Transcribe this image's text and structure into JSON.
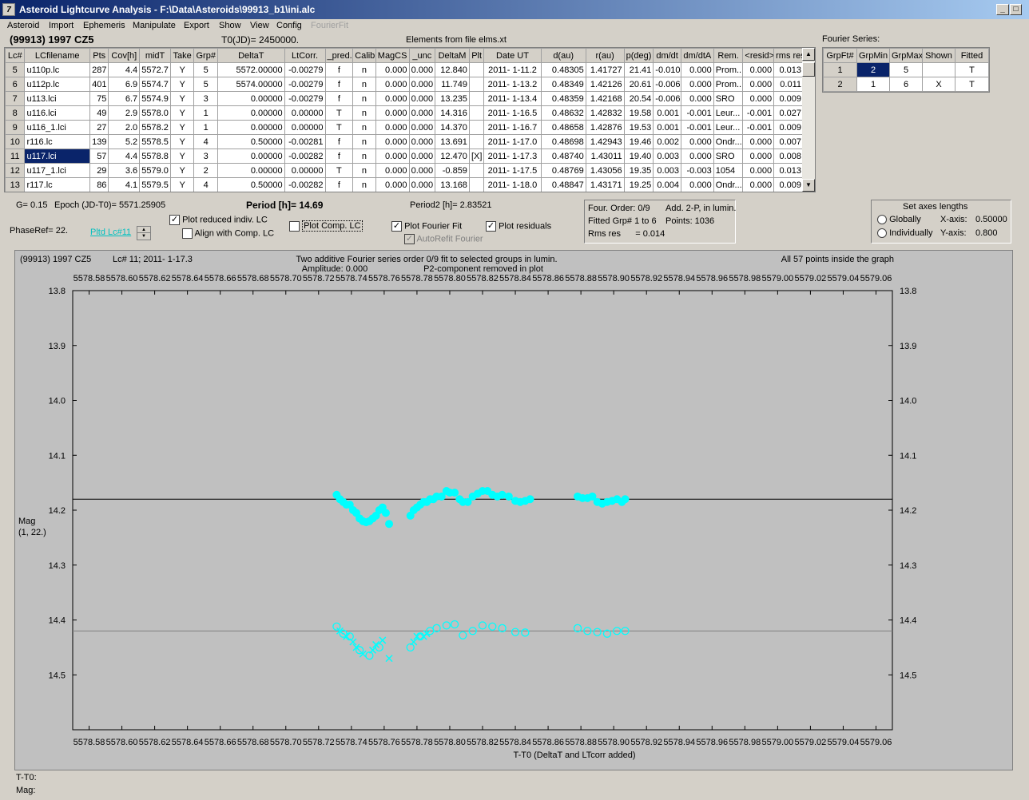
{
  "window": {
    "title": "Asteroid Lightcurve Analysis - F:\\Data\\Asteroids\\99913_b1\\ini.alc",
    "icon": "app-icon"
  },
  "menu": [
    "Asteroid",
    "Import",
    "Ephemeris",
    "Manipulate",
    "Export",
    "Show",
    "View",
    "Config",
    "FourierFit"
  ],
  "header": {
    "object": "(99913) 1997 CZ5",
    "t0": "T0(JD)= 2450000.",
    "elements": "Elements from file elms.xt"
  },
  "table": {
    "columns": [
      "Lc#",
      "LCfilename",
      "Pts",
      "Cov[h]",
      "midT",
      "Take",
      "Grp#",
      "DeltaT",
      "LtCorr.",
      "_pred.",
      "Calib.",
      "MagCS",
      "_unc",
      "DeltaM",
      "Plt",
      "Date UT",
      "d(au)",
      "r(au)",
      "p(deg)",
      "dm/dt",
      "dm/dtA",
      "Rem.",
      "<resid>",
      "rms res"
    ],
    "rows": [
      [
        "5",
        "u110p.lc",
        "287",
        "4.4",
        "5572.7",
        "Y",
        "5",
        "5572.00000",
        "-0.00279",
        "f",
        "n",
        "0.000",
        "0.000",
        "12.840",
        "",
        "2011- 1-11.2",
        "0.48305",
        "1.41727",
        "21.41",
        "-0.010",
        "0.000",
        "Prom...",
        "0.000",
        "0.013"
      ],
      [
        "6",
        "u112p.lc",
        "401",
        "6.9",
        "5574.7",
        "Y",
        "5",
        "5574.00000",
        "-0.00279",
        "f",
        "n",
        "0.000",
        "0.000",
        "11.749",
        "",
        "2011- 1-13.2",
        "0.48349",
        "1.42126",
        "20.61",
        "-0.006",
        "0.000",
        "Prom...",
        "0.000",
        "0.011"
      ],
      [
        "7",
        "u113.lci",
        "75",
        "6.7",
        "5574.9",
        "Y",
        "3",
        "0.00000",
        "-0.00279",
        "f",
        "n",
        "0.000",
        "0.000",
        "13.235",
        "",
        "2011- 1-13.4",
        "0.48359",
        "1.42168",
        "20.54",
        "-0.006",
        "0.000",
        "SRO",
        "0.000",
        "0.009"
      ],
      [
        "8",
        "u116.lci",
        "49",
        "2.9",
        "5578.0",
        "Y",
        "1",
        "0.00000",
        "0.00000",
        "T",
        "n",
        "0.000",
        "0.000",
        "14.316",
        "",
        "2011- 1-16.5",
        "0.48632",
        "1.42832",
        "19.58",
        "0.001",
        "-0.001",
        "Leur...",
        "-0.001",
        "0.027"
      ],
      [
        "9",
        "u116_1.lci",
        "27",
        "2.0",
        "5578.2",
        "Y",
        "1",
        "0.00000",
        "0.00000",
        "T",
        "n",
        "0.000",
        "0.000",
        "14.370",
        "",
        "2011- 1-16.7",
        "0.48658",
        "1.42876",
        "19.53",
        "0.001",
        "-0.001",
        "Leur...",
        "-0.001",
        "0.009"
      ],
      [
        "10",
        "r116.lc",
        "139",
        "5.2",
        "5578.5",
        "Y",
        "4",
        "0.50000",
        "-0.00281",
        "f",
        "n",
        "0.000",
        "0.000",
        "13.691",
        "",
        "2011- 1-17.0",
        "0.48698",
        "1.42943",
        "19.46",
        "0.002",
        "0.000",
        "Ondr...",
        "0.000",
        "0.007"
      ],
      [
        "11",
        "u117.lci",
        "57",
        "4.4",
        "5578.8",
        "Y",
        "3",
        "0.00000",
        "-0.00282",
        "f",
        "n",
        "0.000",
        "0.000",
        "12.470",
        "[X]",
        "2011- 1-17.3",
        "0.48740",
        "1.43011",
        "19.40",
        "0.003",
        "0.000",
        "SRO",
        "0.000",
        "0.008"
      ],
      [
        "12",
        "u117_1.lci",
        "29",
        "3.6",
        "5579.0",
        "Y",
        "2",
        "0.00000",
        "0.00000",
        "T",
        "n",
        "0.000",
        "0.000",
        "-0.859",
        "",
        "2011- 1-17.5",
        "0.48769",
        "1.43056",
        "19.35",
        "0.003",
        "-0.003",
        "1054",
        "0.000",
        "0.013"
      ],
      [
        "13",
        "r117.lc",
        "86",
        "4.1",
        "5579.5",
        "Y",
        "4",
        "0.50000",
        "-0.00282",
        "f",
        "n",
        "0.000",
        "0.000",
        "13.168",
        "",
        "2011- 1-18.0",
        "0.48847",
        "1.43171",
        "19.25",
        "0.004",
        "0.000",
        "Ondr...",
        "0.000",
        "0.009"
      ]
    ],
    "selected_row": "11"
  },
  "fourier": {
    "label": "Fourier Series:",
    "columns": [
      "GrpFt#",
      "GrpMin",
      "GrpMax",
      "Shown",
      "Fitted"
    ],
    "rows": [
      [
        "1",
        "2",
        "5",
        "",
        "T"
      ],
      [
        "2",
        "1",
        "6",
        "X",
        "T"
      ]
    ]
  },
  "controls": {
    "g": "G= 0.15",
    "epoch": "Epoch (JD-T0)= 5571.25905",
    "period": "Period [h]= 14.69",
    "period2": "Period2 [h]= 2.83521",
    "phaseref": "PhaseRef= 22.",
    "plt_lc": "Pltd Lc#11",
    "plot_reduced": "Plot reduced indiv. LC",
    "align_comp": "Align with Comp. LC",
    "plot_comp": "Plot Comp. LC",
    "plot_fourier": "Plot Fourier Fit",
    "plot_residuals": "Plot residuals",
    "autorefit": "AutoRefit Fourier",
    "four_order": "Four. Order:  0/9",
    "add2p": "Add. 2-P, in lumin.",
    "fitted_grp": "Fitted Grp# 1 to 6",
    "points": "Points: 1036",
    "rms": "Rms res      = 0.014",
    "axes_title": "Set axes lengths",
    "globally": "Globally",
    "individually": "Individually",
    "xaxis_label": "X-axis:",
    "xaxis_val": "0.50000",
    "yaxis_label": "Y-axis:",
    "yaxis_val": "0.800"
  },
  "plot": {
    "object": "(99913) 1997 CZ5",
    "lcinfo": "Lc# 11; 2011- 1-17.3",
    "title1": "Two additive Fourier series order 0/9 fit to selected groups in lumin.",
    "title2": "Amplitude: 0.000",
    "title3": "P2-component removed in plot",
    "inside": "All 57 points inside the graph",
    "xlabel": "T-T0 (DeltaT and LTcorr added)",
    "ylabel1": "Mag",
    "ylabel2": "(1, 22.)",
    "point_color": "#00ffff"
  },
  "chart_data": {
    "type": "scatter",
    "xlim": [
      5578.57,
      5579.07
    ],
    "ylim": [
      13.8,
      14.6
    ],
    "x_ticks": [
      "5578.58",
      "5578.60",
      "5578.62",
      "5578.64",
      "5578.66",
      "5578.68",
      "5578.70",
      "5578.72",
      "5578.74",
      "5578.76",
      "5578.78",
      "5578.80",
      "5578.82",
      "5578.84",
      "5578.86",
      "5578.88",
      "5578.90",
      "5578.92",
      "5578.94",
      "5578.96",
      "5578.98",
      "5579.00",
      "5579.02",
      "5579.04",
      "5579.06"
    ],
    "y_ticks": [
      "13.8",
      "13.9",
      "14.0",
      "14.1",
      "14.2",
      "14.3",
      "14.4",
      "14.5"
    ],
    "fit_lines": [
      {
        "name": "Fourier fit",
        "y": 14.18,
        "color": "#000000"
      },
      {
        "name": "residual baseline",
        "y": 14.42,
        "color": "#808080"
      }
    ],
    "series": [
      {
        "marker": "circle-filled",
        "points": [
          [
            5578.731,
            14.172
          ],
          [
            5578.733,
            14.18
          ],
          [
            5578.735,
            14.185
          ],
          [
            5578.737,
            14.19
          ],
          [
            5578.739,
            14.19
          ],
          [
            5578.741,
            14.2
          ],
          [
            5578.743,
            14.205
          ],
          [
            5578.745,
            14.215
          ],
          [
            5578.747,
            14.22
          ],
          [
            5578.749,
            14.222
          ],
          [
            5578.751,
            14.22
          ],
          [
            5578.753,
            14.215
          ],
          [
            5578.755,
            14.21
          ],
          [
            5578.757,
            14.2
          ],
          [
            5578.759,
            14.195
          ],
          [
            5578.761,
            14.205
          ],
          [
            5578.763,
            14.225
          ],
          [
            5578.776,
            14.21
          ],
          [
            5578.778,
            14.2
          ],
          [
            5578.78,
            14.195
          ],
          [
            5578.782,
            14.19
          ],
          [
            5578.784,
            14.185
          ],
          [
            5578.786,
            14.185
          ],
          [
            5578.788,
            14.18
          ],
          [
            5578.79,
            14.18
          ],
          [
            5578.792,
            14.175
          ],
          [
            5578.795,
            14.175
          ],
          [
            5578.798,
            14.165
          ],
          [
            5578.8,
            14.168
          ],
          [
            5578.803,
            14.168
          ],
          [
            5578.806,
            14.18
          ],
          [
            5578.808,
            14.185
          ],
          [
            5578.811,
            14.185
          ],
          [
            5578.814,
            14.175
          ],
          [
            5578.817,
            14.17
          ],
          [
            5578.82,
            14.165
          ],
          [
            5578.823,
            14.165
          ],
          [
            5578.826,
            14.172
          ],
          [
            5578.829,
            14.175
          ],
          [
            5578.832,
            14.172
          ],
          [
            5578.836,
            14.175
          ],
          [
            5578.84,
            14.183
          ],
          [
            5578.843,
            14.185
          ],
          [
            5578.846,
            14.183
          ],
          [
            5578.849,
            14.18
          ],
          [
            5578.878,
            14.175
          ],
          [
            5578.881,
            14.178
          ],
          [
            5578.884,
            14.178
          ],
          [
            5578.887,
            14.175
          ],
          [
            5578.89,
            14.185
          ],
          [
            5578.893,
            14.188
          ],
          [
            5578.896,
            14.185
          ],
          [
            5578.899,
            14.183
          ],
          [
            5578.902,
            14.18
          ],
          [
            5578.905,
            14.185
          ],
          [
            5578.907,
            14.18
          ]
        ]
      },
      {
        "marker": "circle-open",
        "points": [
          [
            5578.731,
            14.412
          ],
          [
            5578.735,
            14.425
          ],
          [
            5578.739,
            14.43
          ],
          [
            5578.745,
            14.455
          ],
          [
            5578.751,
            14.465
          ],
          [
            5578.757,
            14.45
          ],
          [
            5578.776,
            14.45
          ],
          [
            5578.782,
            14.43
          ],
          [
            5578.788,
            14.42
          ],
          [
            5578.792,
            14.415
          ],
          [
            5578.798,
            14.41
          ],
          [
            5578.803,
            14.408
          ],
          [
            5578.808,
            14.428
          ],
          [
            5578.814,
            14.42
          ],
          [
            5578.82,
            14.41
          ],
          [
            5578.826,
            14.412
          ],
          [
            5578.832,
            14.415
          ],
          [
            5578.84,
            14.422
          ],
          [
            5578.846,
            14.423
          ],
          [
            5578.878,
            14.415
          ],
          [
            5578.884,
            14.42
          ],
          [
            5578.89,
            14.422
          ],
          [
            5578.896,
            14.425
          ],
          [
            5578.902,
            14.42
          ],
          [
            5578.907,
            14.42
          ]
        ]
      },
      {
        "marker": "x",
        "points": [
          [
            5578.733,
            14.42
          ],
          [
            5578.737,
            14.43
          ],
          [
            5578.741,
            14.44
          ],
          [
            5578.743,
            14.45
          ],
          [
            5578.747,
            14.462
          ],
          [
            5578.753,
            14.455
          ],
          [
            5578.755,
            14.445
          ],
          [
            5578.759,
            14.437
          ],
          [
            5578.763,
            14.47
          ],
          [
            5578.778,
            14.44
          ],
          [
            5578.78,
            14.43
          ],
          [
            5578.784,
            14.43
          ],
          [
            5578.786,
            14.425
          ]
        ]
      }
    ]
  },
  "status": {
    "t_t0": "T-T0:",
    "mag": "Mag:"
  }
}
